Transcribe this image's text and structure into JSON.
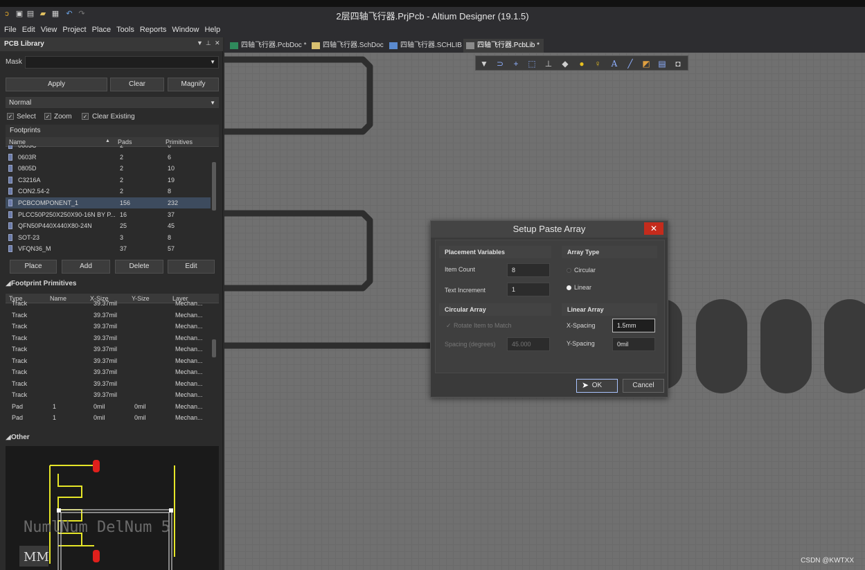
{
  "window": {
    "title": "2层四轴飞行器.PrjPcb - Altium Designer (19.1.5)"
  },
  "menu": [
    "File",
    "Edit",
    "View",
    "Project",
    "Place",
    "Tools",
    "Reports",
    "Window",
    "Help"
  ],
  "panel": {
    "title": "PCB Library",
    "mask_label": "Mask",
    "mask_value": "",
    "buttons": {
      "apply": "Apply",
      "clear": "Clear",
      "magnify": "Magnify"
    },
    "mode": "Normal",
    "options": {
      "select": "Select",
      "zoom": "Zoom",
      "clear_existing": "Clear Existing"
    },
    "footprints": {
      "header": "Footprints",
      "columns": [
        "Name",
        "Pads",
        "Primitives"
      ],
      "rows": [
        {
          "name": "0603C",
          "pads": "2",
          "prims": "6"
        },
        {
          "name": "0603R",
          "pads": "2",
          "prims": "6"
        },
        {
          "name": "0805D",
          "pads": "2",
          "prims": "10"
        },
        {
          "name": "C3216A",
          "pads": "2",
          "prims": "19"
        },
        {
          "name": "CON2.54-2",
          "pads": "2",
          "prims": "8"
        },
        {
          "name": "PCBCOMPONENT_1",
          "pads": "156",
          "prims": "232"
        },
        {
          "name": "PLCC50P250X250X90-16N BY P...",
          "pads": "16",
          "prims": "37"
        },
        {
          "name": "QFN50P440X440X80-24N",
          "pads": "25",
          "prims": "45"
        },
        {
          "name": "SOT-23",
          "pads": "3",
          "prims": "8"
        },
        {
          "name": "VFQN36_M",
          "pads": "37",
          "prims": "57"
        }
      ],
      "buttons": {
        "place": "Place",
        "add": "Add",
        "delete": "Delete",
        "edit": "Edit"
      }
    },
    "primitives": {
      "header": "Footprint Primitives",
      "columns": [
        "Type",
        "Name",
        "X-Size",
        "Y-Size",
        "Layer"
      ],
      "rows": [
        {
          "type": "Track",
          "name": "",
          "x": "39.37mil",
          "y": "",
          "layer": "Mechan..."
        },
        {
          "type": "Track",
          "name": "",
          "x": "39.37mil",
          "y": "",
          "layer": "Mechan..."
        },
        {
          "type": "Track",
          "name": "",
          "x": "39.37mil",
          "y": "",
          "layer": "Mechan..."
        },
        {
          "type": "Track",
          "name": "",
          "x": "39.37mil",
          "y": "",
          "layer": "Mechan..."
        },
        {
          "type": "Track",
          "name": "",
          "x": "39.37mil",
          "y": "",
          "layer": "Mechan..."
        },
        {
          "type": "Track",
          "name": "",
          "x": "39.37mil",
          "y": "",
          "layer": "Mechan..."
        },
        {
          "type": "Track",
          "name": "",
          "x": "39.37mil",
          "y": "",
          "layer": "Mechan..."
        },
        {
          "type": "Track",
          "name": "",
          "x": "39.37mil",
          "y": "",
          "layer": "Mechan..."
        },
        {
          "type": "Track",
          "name": "",
          "x": "39.37mil",
          "y": "",
          "layer": "Mechan..."
        },
        {
          "type": "Pad",
          "name": "1",
          "x": "0mil",
          "y": "0mil",
          "layer": "Mechan..."
        },
        {
          "type": "Pad",
          "name": "1",
          "x": "0mil",
          "y": "0mil",
          "layer": "Mechan..."
        }
      ]
    },
    "other": {
      "header": "Other",
      "preview_text": "NumlNum DelNum 5",
      "preview_unit": "MM"
    }
  },
  "tabs": [
    {
      "label": "四轴飞行器.PcbDoc *",
      "icon": "pcb-doc-icon"
    },
    {
      "label": "四轴飞行器.SchDoc",
      "icon": "sch-doc-icon"
    },
    {
      "label": "四轴飞行器.SCHLIB",
      "icon": "schlib-icon"
    },
    {
      "label": "四轴飞行器.PcbLib *",
      "icon": "pcblib-icon"
    }
  ],
  "dialog": {
    "title": "Setup Paste Array",
    "placement": {
      "header": "Placement Variables",
      "item_count_label": "Item Count",
      "item_count": "8",
      "text_increment_label": "Text Increment",
      "text_increment": "1"
    },
    "array_type": {
      "header": "Array Type",
      "circular": "Circular",
      "linear": "Linear",
      "selected": "Linear"
    },
    "circular": {
      "header": "Circular Array",
      "rotate_label": "Rotate Item to Match",
      "spacing_label": "Spacing (degrees)",
      "spacing": "45.000"
    },
    "linear": {
      "header": "Linear Array",
      "x_label": "X-Spacing",
      "x_value": "1.5mm",
      "y_label": "Y-Spacing",
      "y_value": "0mil"
    },
    "ok": "OK",
    "cancel": "Cancel"
  },
  "watermark": "CSDN @KWTXX",
  "colors": {
    "accent": "#3d4b5e",
    "close_red": "#c42b1c",
    "preview_yellow": "#e6e628",
    "pad_red": "#e0201c"
  }
}
